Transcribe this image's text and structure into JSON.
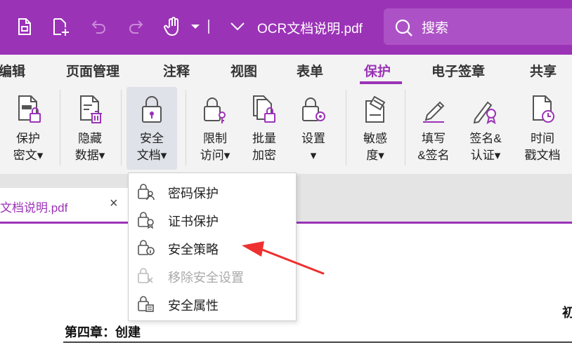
{
  "colors": {
    "accent": "#9b33b7",
    "search_bg": "#ad52c6",
    "ribbon_bg": "#f3f3f3",
    "arrow": "#ee3030"
  },
  "titlebar": {
    "icons": [
      "file-new-icon",
      "file-add-icon",
      "undo-icon",
      "redo-icon",
      "hand-tool-icon",
      "dropdown-chevron-icon",
      "quick-access-chevron-icon"
    ],
    "document_title": "OCR文档说明.pdf",
    "search_label": "搜索"
  },
  "menu_tabs": [
    "编辑",
    "页面管理",
    "注释",
    "视图",
    "表单",
    "保护",
    "电子签章",
    "共享"
  ],
  "active_tab": "保护",
  "ribbon": {
    "protect_encrypt": {
      "line1": "保护",
      "line2": "密文▾"
    },
    "hide_data": {
      "line1": "隐藏",
      "line2": "数据▾"
    },
    "secure_doc": {
      "line1": "安全",
      "line2": "文档▾"
    },
    "restrict_access": {
      "line1": "限制",
      "line2": "访问▾"
    },
    "batch_encrypt": {
      "line1": "批量",
      "line2": "加密"
    },
    "settings": {
      "line1": "设置",
      "line2": "▾"
    },
    "sensitivity": {
      "line1": "敏感",
      "line2": "度▾"
    },
    "fill_sign": {
      "line1": "填写",
      "line2": "&签名"
    },
    "sign_cert": {
      "line1": "签名&",
      "line2": "认证▾"
    },
    "timestamp": {
      "line1": "时间",
      "line2": "戳文档"
    }
  },
  "doc_tab": {
    "label": "文档说明.pdf",
    "close": "×"
  },
  "dropdown": {
    "password_protect": "密码保护",
    "cert_protect": "证书保护",
    "security_policy": "安全策略",
    "remove_security": "移除安全设置",
    "security_properties": "安全属性"
  },
  "document": {
    "chapter_heading": "第四章：创建",
    "edge_glyph": "初"
  }
}
